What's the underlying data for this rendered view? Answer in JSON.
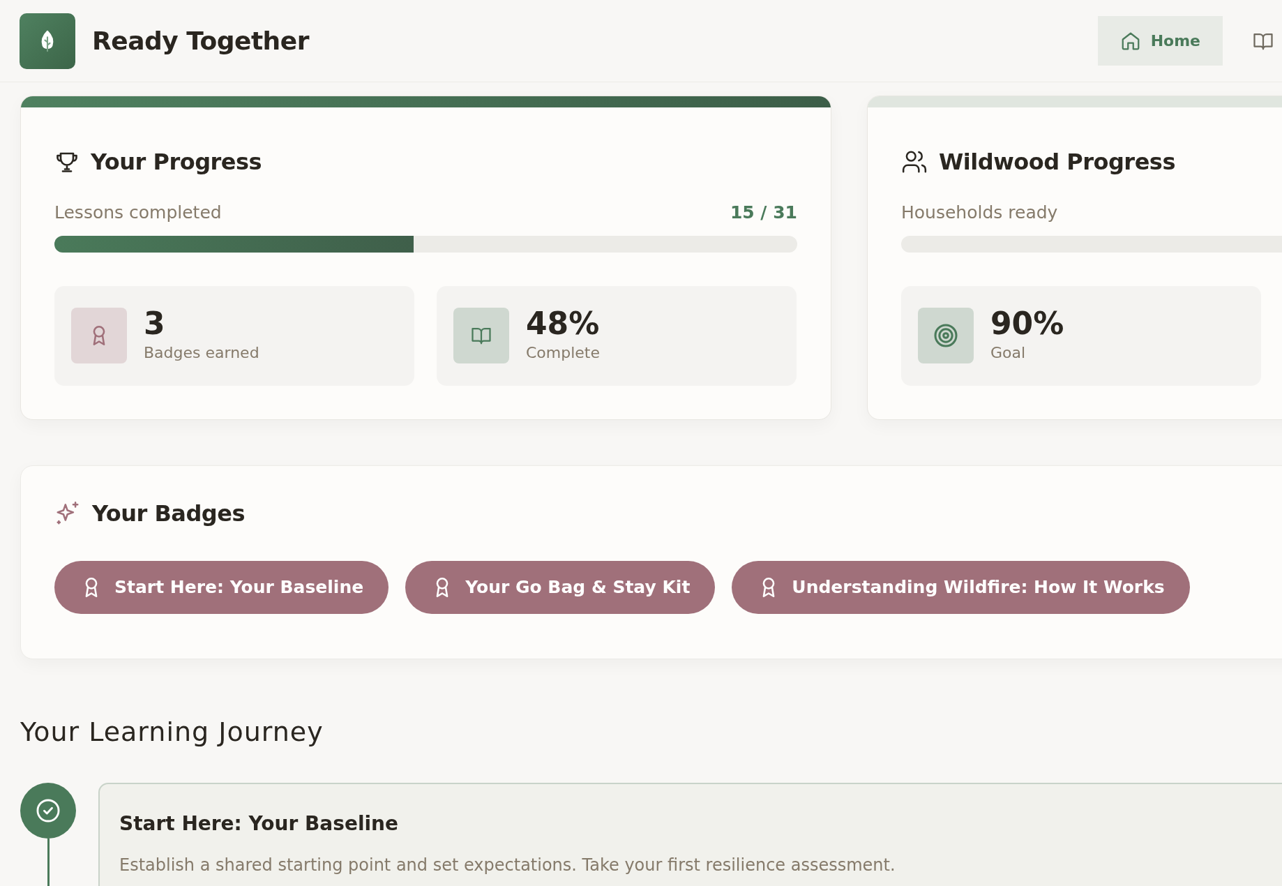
{
  "app": {
    "title": "Ready Together"
  },
  "nav": [
    {
      "label": "Home",
      "selected": true
    },
    {
      "selected": false
    }
  ],
  "progress": {
    "title": "Your Progress",
    "label": "Lessons completed",
    "reading": "15 / 31",
    "level": 0.484,
    "stats": [
      {
        "value": "3",
        "label": "Badges earned",
        "color": "#a0707a"
      },
      {
        "value": "48%",
        "label": "Complete",
        "color": "#4a7a5a"
      }
    ]
  },
  "community": {
    "title": "Wildwood Progress",
    "label": "Households ready",
    "level": 0,
    "stats": [
      {
        "value": "90%",
        "label": "Goal",
        "color": "#4a7a5a"
      }
    ]
  },
  "badges": {
    "title": "Your Badges",
    "items": [
      "Start Here: Your Baseline",
      "Your Go Bag & Stay Kit",
      "Understanding Wildfire: How It Works"
    ]
  },
  "journey": {
    "title": "Your Learning Journey",
    "items": [
      {
        "title": "Start Here: Your Baseline",
        "description": "Establish a shared starting point and set expectations. Take your first resilience assessment.",
        "completed": true
      }
    ]
  }
}
